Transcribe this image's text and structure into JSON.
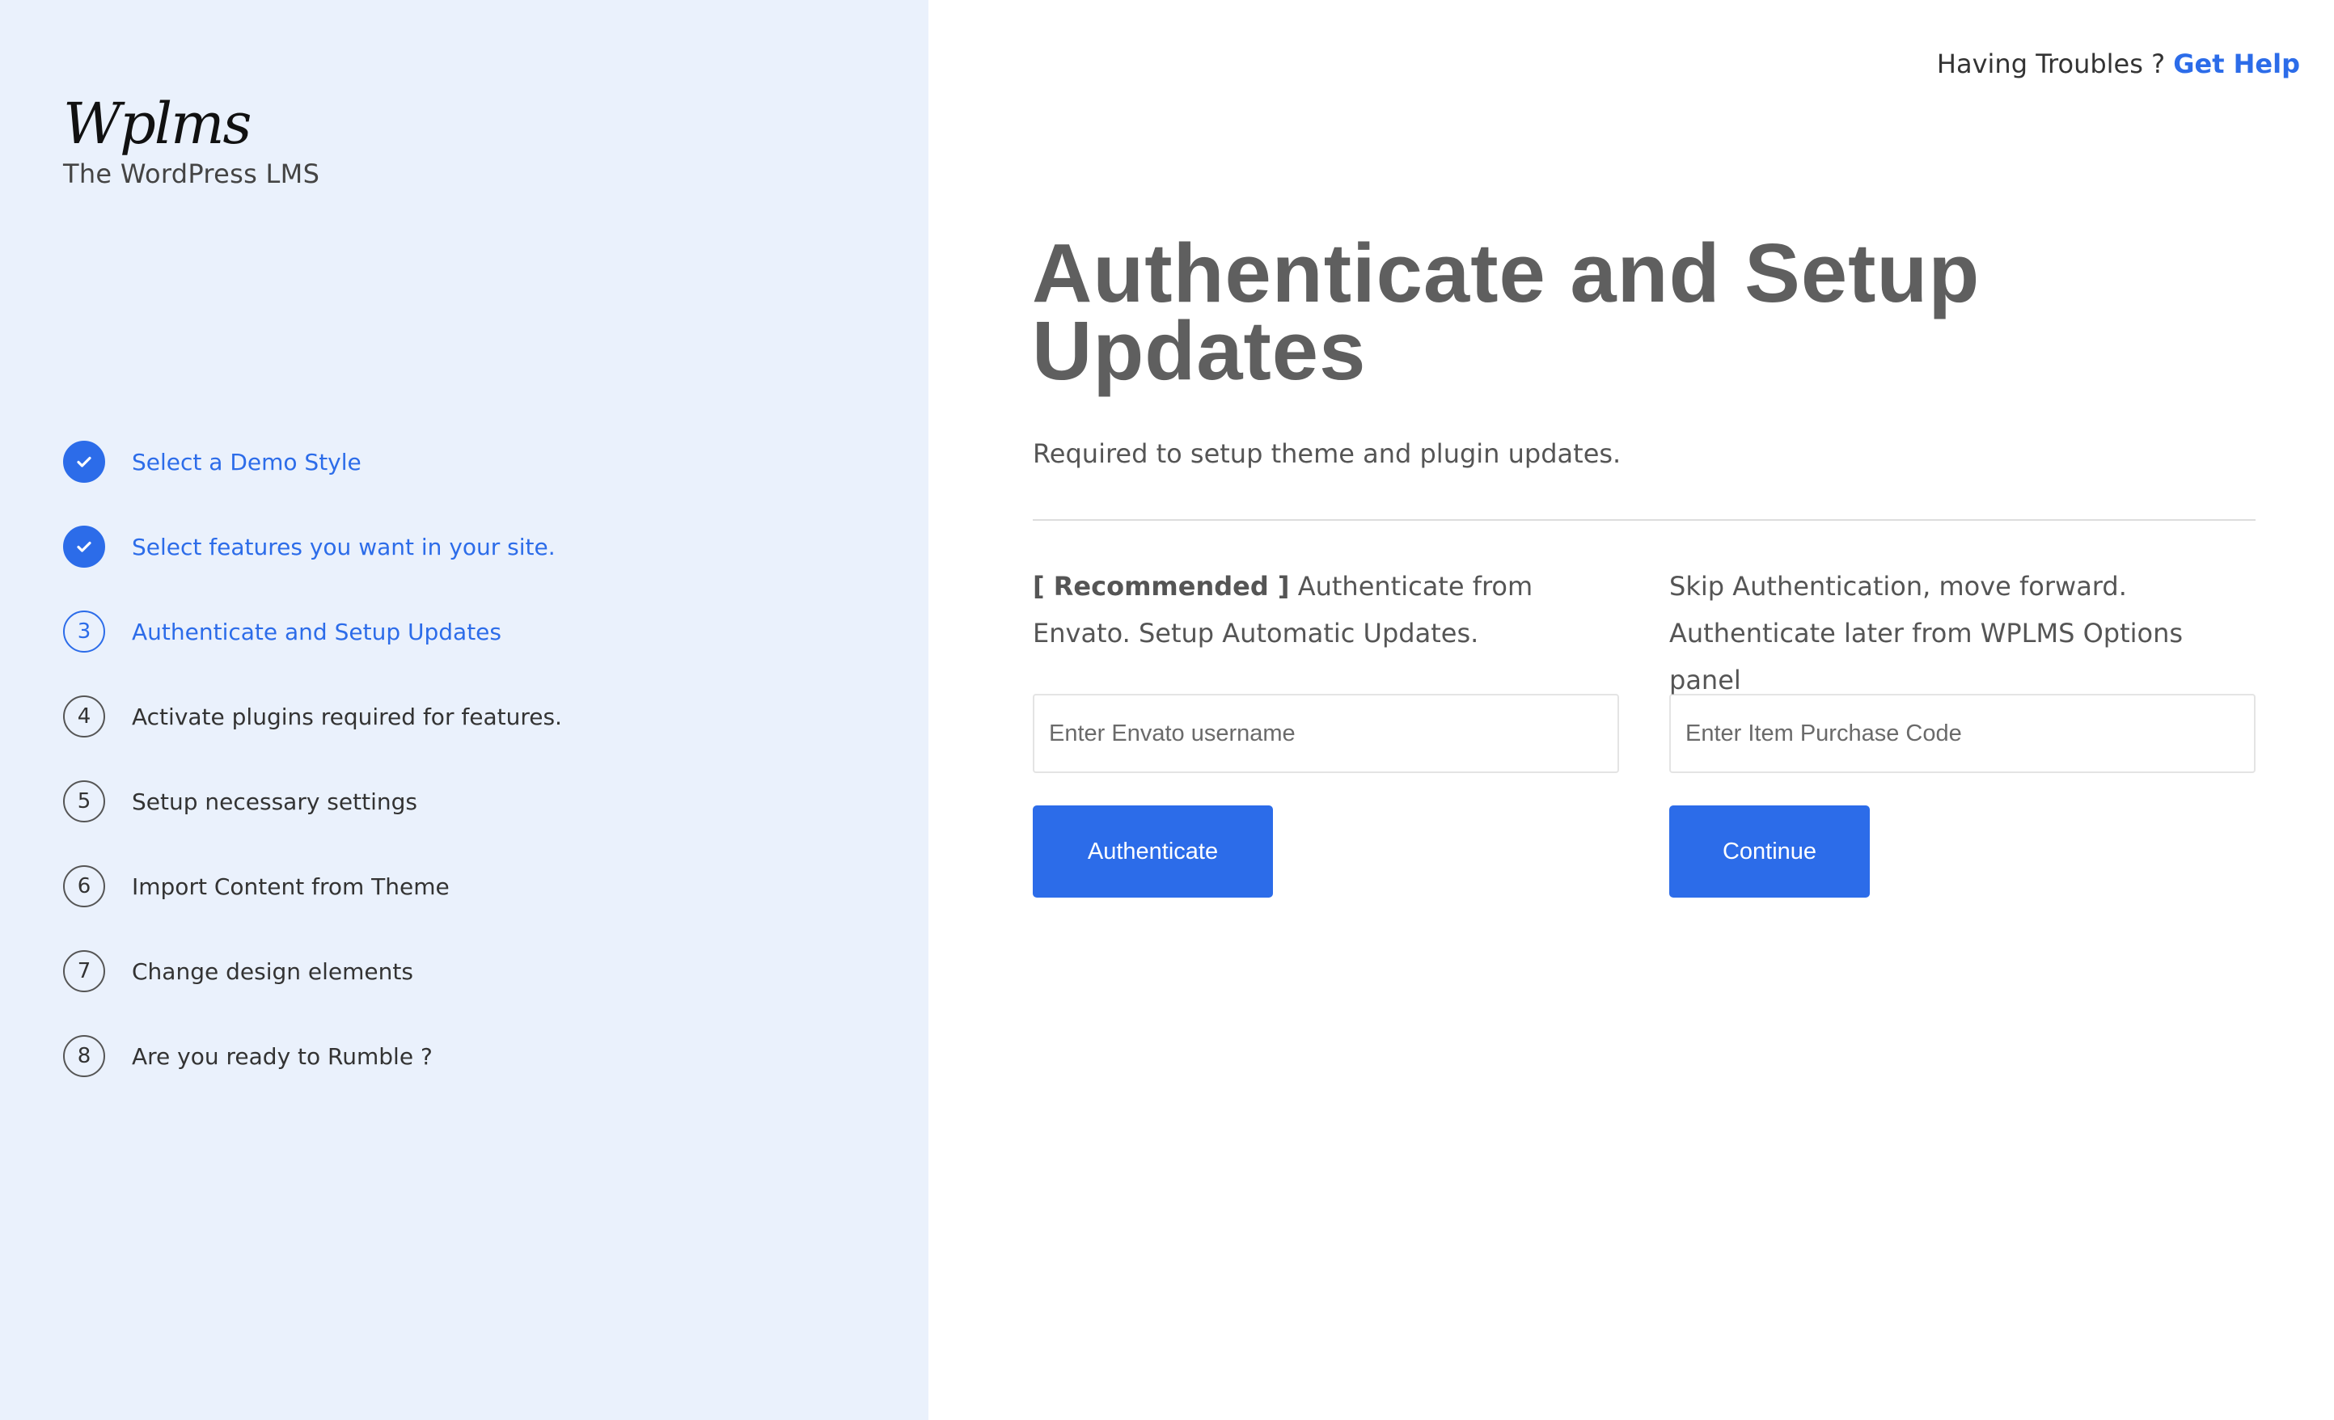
{
  "sidebar": {
    "logo": "Wplms",
    "tagline": "The WordPress LMS",
    "steps": [
      {
        "badge": "",
        "label": "Select a Demo Style",
        "state": "done"
      },
      {
        "badge": "",
        "label": "Select features you want in your site.",
        "state": "done"
      },
      {
        "badge": "3",
        "label": "Authenticate and Setup Updates",
        "state": "current"
      },
      {
        "badge": "4",
        "label": "Activate plugins required for features.",
        "state": "pending"
      },
      {
        "badge": "5",
        "label": "Setup necessary settings",
        "state": "pending"
      },
      {
        "badge": "6",
        "label": "Import Content from Theme",
        "state": "pending"
      },
      {
        "badge": "7",
        "label": "Change design elements",
        "state": "pending"
      },
      {
        "badge": "8",
        "label": "Are you ready to Rumble ?",
        "state": "pending"
      }
    ]
  },
  "header": {
    "help_text": "Having Troubles ?",
    "help_link": "Get Help"
  },
  "main": {
    "title": "Authenticate and Setup Updates",
    "subtitle": "Required to setup theme and plugin updates.",
    "left": {
      "recommended": "[ Recommended ]",
      "description": "Authenticate from Envato. Setup Automatic Updates.",
      "input_placeholder": "Enter Envato username",
      "input_value": "",
      "button": "Authenticate"
    },
    "right": {
      "description": "Skip Authentication, move forward. Authenticate later from WPLMS Options panel",
      "input_placeholder": "Enter Item Purchase Code",
      "input_value": "",
      "button": "Continue"
    }
  },
  "colors": {
    "accent": "#2c6ce9",
    "sidebar_bg": "#eaf1fc",
    "title": "#5f5f5f"
  },
  "icons": {
    "done_step": "checkmark-icon"
  }
}
